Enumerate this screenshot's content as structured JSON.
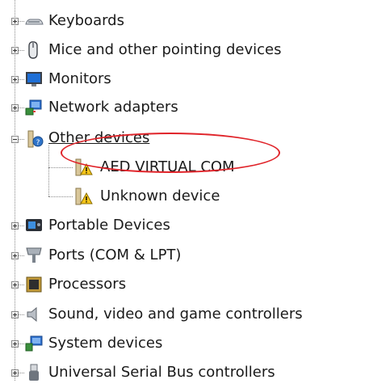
{
  "device_manager": {
    "categories": [
      {
        "label": "Keyboards",
        "icon": "keyboard-icon",
        "state": "collapsed"
      },
      {
        "label": "Mice and other pointing devices",
        "icon": "mouse-icon",
        "state": "collapsed"
      },
      {
        "label": "Monitors",
        "icon": "monitor-icon",
        "state": "collapsed"
      },
      {
        "label": "Network adapters",
        "icon": "network-adapter-icon",
        "state": "collapsed"
      },
      {
        "label": "Other devices",
        "icon": "unknown-device-icon",
        "state": "expanded",
        "children": [
          {
            "label": "AED VIRTUAL COM",
            "icon": "warning-device-icon",
            "highlighted": true
          },
          {
            "label": "Unknown device",
            "icon": "warning-device-icon"
          }
        ]
      },
      {
        "label": "Portable Devices",
        "icon": "portable-device-icon",
        "state": "collapsed"
      },
      {
        "label": "Ports (COM & LPT)",
        "icon": "port-icon",
        "state": "collapsed"
      },
      {
        "label": "Processors",
        "icon": "processor-icon",
        "state": "collapsed"
      },
      {
        "label": "Sound, video and game controllers",
        "icon": "speaker-icon",
        "state": "collapsed"
      },
      {
        "label": "System devices",
        "icon": "system-devices-icon",
        "state": "collapsed"
      },
      {
        "label": "Universal Serial Bus controllers",
        "icon": "usb-icon",
        "state": "collapsed"
      }
    ]
  },
  "annotation": {
    "color": "#e0242a",
    "target": "AED VIRTUAL COM"
  }
}
